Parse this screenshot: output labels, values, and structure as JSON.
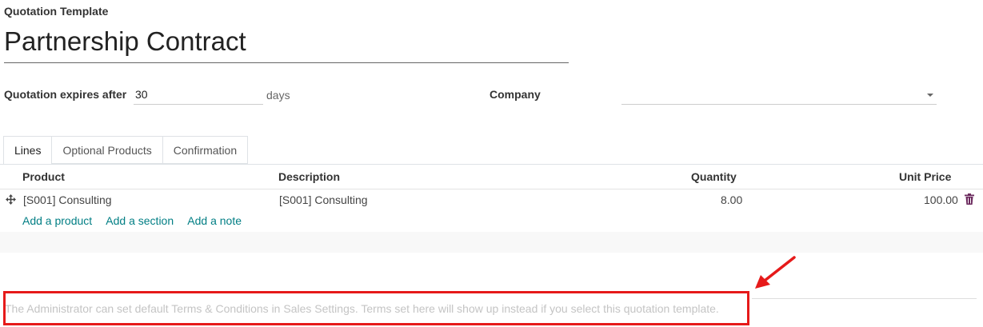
{
  "form": {
    "label": "Quotation Template",
    "title": "Partnership Contract",
    "expires_label": "Quotation expires after",
    "expires_value": "30",
    "expires_unit": "days",
    "company_label": "Company",
    "company_value": ""
  },
  "tabs": [
    {
      "label": "Lines",
      "active": true
    },
    {
      "label": "Optional Products",
      "active": false
    },
    {
      "label": "Confirmation",
      "active": false
    }
  ],
  "lines": {
    "columns": {
      "product": "Product",
      "description": "Description",
      "quantity": "Quantity",
      "unit_price": "Unit Price"
    },
    "rows": [
      {
        "product": "[S001] Consulting",
        "description": "[S001] Consulting",
        "quantity": "8.00",
        "unit_price": "100.00"
      }
    ],
    "add_links": [
      "Add a product",
      "Add a section",
      "Add a note"
    ]
  },
  "terms_placeholder": "The Administrator can set default Terms & Conditions in Sales Settings. Terms set here will show up instead if you select this quotation template.",
  "icons": {
    "drag": "drag-handle-icon",
    "delete": "trash-icon",
    "dropdown": "caret-down-icon",
    "annotation": "red-arrow-icon"
  },
  "colors": {
    "link": "#017e84",
    "highlight": "#e61a1a",
    "trash": "#6b2a5e"
  }
}
